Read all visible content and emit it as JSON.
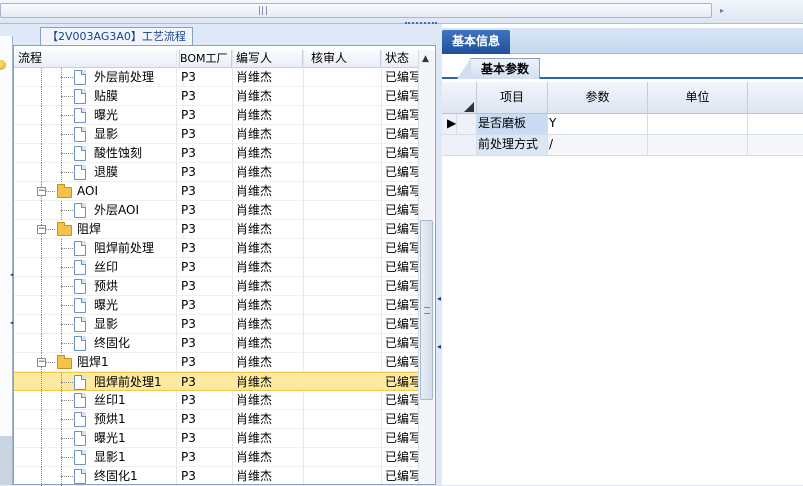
{
  "process_panel": {
    "tab_title": "【2V003AG3A0】工艺流程",
    "columns": [
      "流程",
      "BOM工厂",
      "编写人",
      "核审人",
      "状态"
    ],
    "rows": [
      {
        "type": "leaf",
        "label": "外层前处理",
        "bom": "P3",
        "writer": "肖维杰",
        "reviewer": "",
        "status": "已编写"
      },
      {
        "type": "leaf",
        "label": "贴膜",
        "bom": "P3",
        "writer": "肖维杰",
        "reviewer": "",
        "status": "已编写"
      },
      {
        "type": "leaf",
        "label": "曝光",
        "bom": "P3",
        "writer": "肖维杰",
        "reviewer": "",
        "status": "已编写"
      },
      {
        "type": "leaf",
        "label": "显影",
        "bom": "P3",
        "writer": "肖维杰",
        "reviewer": "",
        "status": "已编写"
      },
      {
        "type": "leaf",
        "label": "酸性蚀刻",
        "bom": "P3",
        "writer": "肖维杰",
        "reviewer": "",
        "status": "已编写"
      },
      {
        "type": "leaf",
        "label": "退膜",
        "bom": "P3",
        "writer": "肖维杰",
        "reviewer": "",
        "status": "已编写"
      },
      {
        "type": "group",
        "label": "AOI",
        "bom": "P3",
        "writer": "肖维杰",
        "reviewer": "",
        "status": "已编写"
      },
      {
        "type": "leaf",
        "label": "外层AOI",
        "bom": "P3",
        "writer": "肖维杰",
        "reviewer": "",
        "status": "已编写"
      },
      {
        "type": "group",
        "label": "阻焊",
        "bom": "P3",
        "writer": "肖维杰",
        "reviewer": "",
        "status": "已编写"
      },
      {
        "type": "leaf",
        "label": "阻焊前处理",
        "bom": "P3",
        "writer": "肖维杰",
        "reviewer": "",
        "status": "已编写"
      },
      {
        "type": "leaf",
        "label": "丝印",
        "bom": "P3",
        "writer": "肖维杰",
        "reviewer": "",
        "status": "已编写"
      },
      {
        "type": "leaf",
        "label": "预烘",
        "bom": "P3",
        "writer": "肖维杰",
        "reviewer": "",
        "status": "已编写"
      },
      {
        "type": "leaf",
        "label": "曝光",
        "bom": "P3",
        "writer": "肖维杰",
        "reviewer": "",
        "status": "已编写"
      },
      {
        "type": "leaf",
        "label": "显影",
        "bom": "P3",
        "writer": "肖维杰",
        "reviewer": "",
        "status": "已编写"
      },
      {
        "type": "leaf",
        "label": "终固化",
        "bom": "P3",
        "writer": "肖维杰",
        "reviewer": "",
        "status": "已编写"
      },
      {
        "type": "group",
        "label": "阻焊1",
        "bom": "P3",
        "writer": "肖维杰",
        "reviewer": "",
        "status": "已编写"
      },
      {
        "type": "leaf",
        "label": "阻焊前处理1",
        "bom": "P3",
        "writer": "肖维杰",
        "reviewer": "",
        "status": "已编写",
        "selected": true
      },
      {
        "type": "leaf",
        "label": "丝印1",
        "bom": "P3",
        "writer": "肖维杰",
        "reviewer": "",
        "status": "已编写"
      },
      {
        "type": "leaf",
        "label": "预烘1",
        "bom": "P3",
        "writer": "肖维杰",
        "reviewer": "",
        "status": "已编写"
      },
      {
        "type": "leaf",
        "label": "曝光1",
        "bom": "P3",
        "writer": "肖维杰",
        "reviewer": "",
        "status": "已编写"
      },
      {
        "type": "leaf",
        "label": "显影1",
        "bom": "P3",
        "writer": "肖维杰",
        "reviewer": "",
        "status": "已编写"
      },
      {
        "type": "leaf",
        "label": "终固化1",
        "bom": "P3",
        "writer": "肖维杰",
        "reviewer": "",
        "status": "已编写"
      }
    ]
  },
  "info_panel": {
    "title": "基本信息",
    "subtab": "基本参数",
    "columns": [
      "项目",
      "参数",
      "单位"
    ],
    "rows": [
      {
        "item": "是否磨板",
        "param": "Y",
        "unit": ""
      },
      {
        "item": "前处理方式",
        "param": "/",
        "unit": ""
      }
    ]
  },
  "colors": {
    "selected_row": "#fde9a0",
    "info_tab": "#2a5ba8",
    "panel_border": "#8aa0bf"
  }
}
